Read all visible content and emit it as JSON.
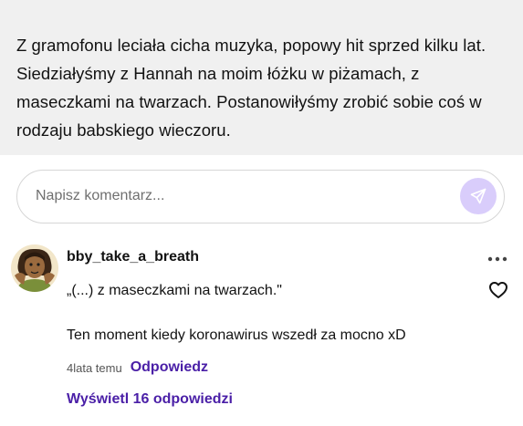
{
  "excerpt": {
    "text": "Z gramofonu leciała cicha muzyka, popowy hit sprzed kilku lat. Siedziałyśmy z Hannah na moim łóżku w piżamach, z maseczkami na twarzach. Postanowiłyśmy zrobić sobie coś w rodzaju babskiego wieczoru."
  },
  "comment_form": {
    "placeholder": "Napisz komentarz...",
    "value": ""
  },
  "comment": {
    "username": "bby_take_a_breath",
    "quote": "„(...) z maseczkami na twarzach.\"",
    "text": "Ten moment kiedy koronawirus wszedł za mocno xD",
    "timestamp": "4lata temu",
    "reply_label": "Odpowiedz",
    "view_replies_label": "Wyświetl 16 odpowiedzi"
  },
  "colors": {
    "accent": "#4a1fa7",
    "send_button_bg": "#d9cdfb",
    "excerpt_bg": "#f0f0f0"
  },
  "icons": {
    "send": "send-icon",
    "more": "more-options-icon",
    "like": "heart-icon"
  }
}
